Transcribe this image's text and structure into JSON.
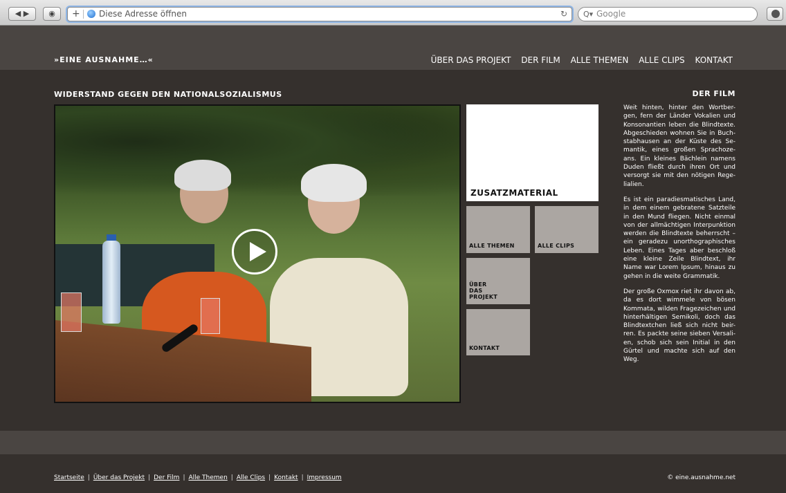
{
  "browser": {
    "address_placeholder": "Diese Adresse öffnen",
    "search_placeholder": "Google"
  },
  "site": {
    "logo": "»EINE AUSNAHME…«",
    "nav": [
      "ÜBER DAS PROJEKT",
      "DER FILM",
      "ALLE THEMEN",
      "ALLE CLIPS",
      "KONTAKT"
    ]
  },
  "main": {
    "section_title": "WIDERSTAND GEGEN DEN NATIONALSOZIALISMUS",
    "tiles": {
      "zusatz": "ZUSATZMATERIAL",
      "themen": "ALLE THEMEN",
      "clips": "ALLE CLIPS",
      "projekt": "ÜBER DAS PROJEKT",
      "kontakt": "KONTAKT"
    }
  },
  "sidebar": {
    "title": "DER FILM",
    "paragraphs": [
      "Weit hinten, hinter den Wortber-gen, fern der Länder Vokalien und Konsonantien leben die Blindtexte. Abgeschieden wohnen Sie in Buch-stabhausen an der Küste des Se-mantik, eines großen Sprachoze-ans. Ein kleines Bächlein namens Duden fließt durch ihren Ort und versorgt sie mit den nötigen Rege-lialien.",
      "Es ist ein paradiesmatisches Land, in dem einem gebratene Satzteile in den Mund fliegen. Nicht einmal von der allmächtigen Interpunktion werden die Blindtexte beherrscht – ein geradezu unorthographisches Leben. Eines Tages aber beschloß eine kleine Zeile Blindtext, ihr Name war Lorem Ipsum, hinaus zu gehen in die weite Grammatik.",
      "Der große Oxmox riet ihr davon ab, da es dort wimmele von bösen Kommata, wilden Fragezeichen und hinterhältigen Semikoli, doch das Blindtextchen ließ sich nicht beir-ren. Es packte seine sieben Versali-en, schob sich sein Initial in den Gürtel und machte sich auf den Weg."
    ]
  },
  "footer": {
    "links": [
      "Startseite",
      "Über das Projekt",
      "Der Film",
      "Alle Themen",
      "Alle Clips",
      "Kontakt",
      "Impressum"
    ],
    "copyright": "© eine.ausnahme.net"
  }
}
